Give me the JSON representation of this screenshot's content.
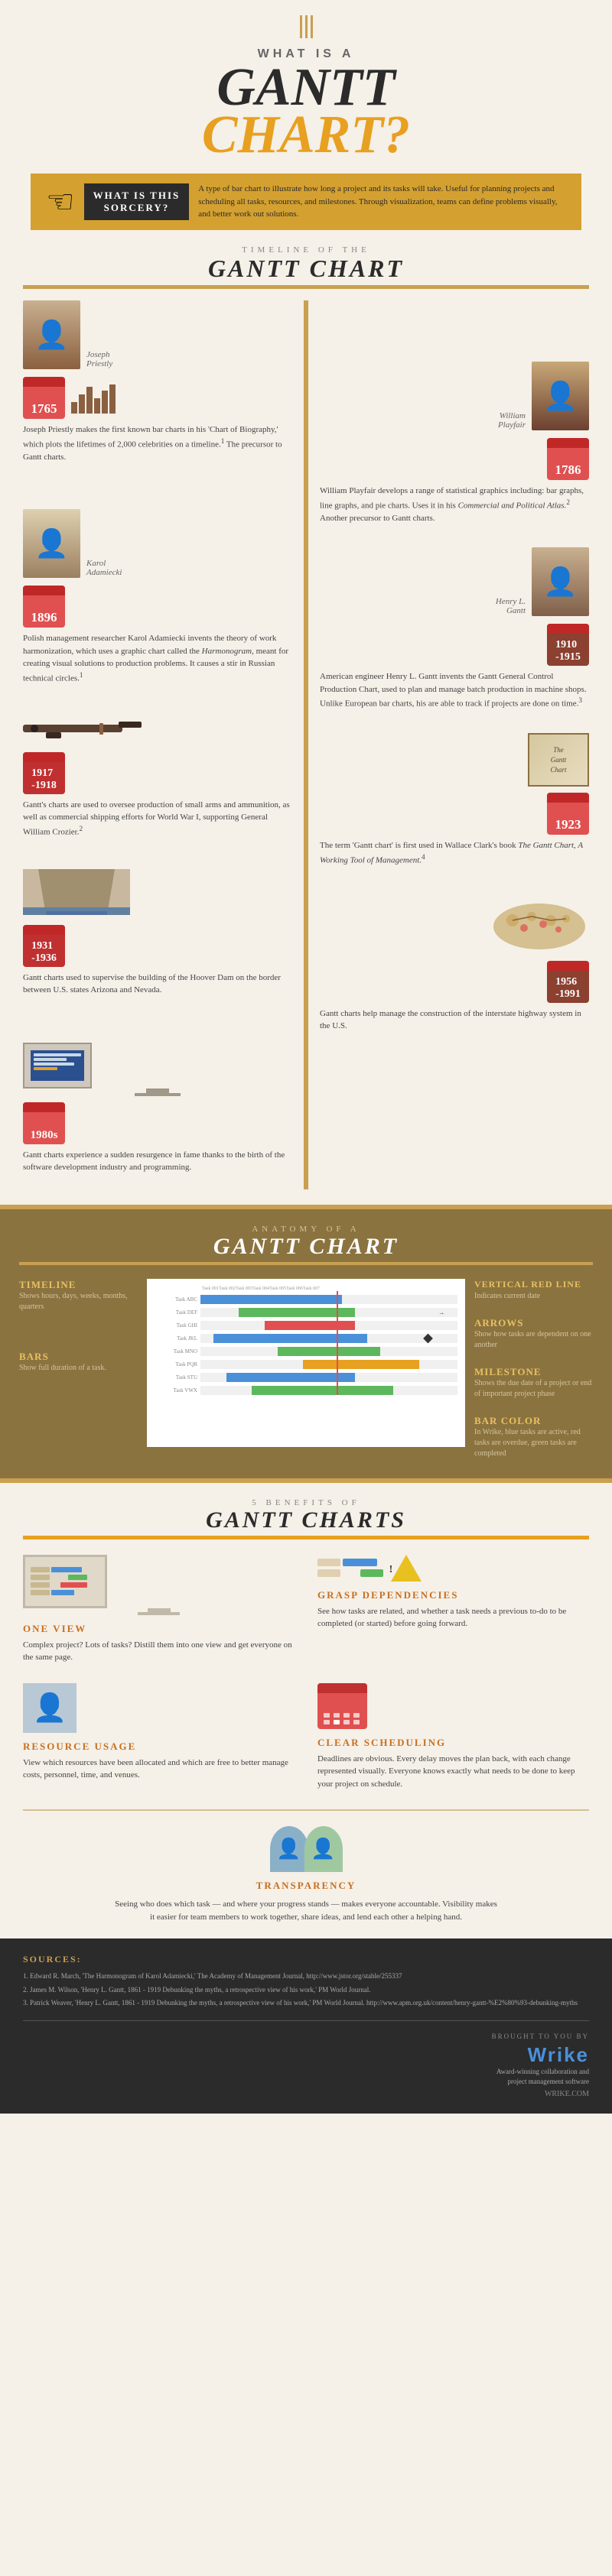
{
  "header": {
    "what_is_label": "WHAT IS A",
    "gantt_label": "GANTT",
    "chart_label": "CHART?",
    "sorcery_title": "WHAT IS THIS",
    "sorcery_title2": "SORCERY?",
    "sorcery_desc": "A type of bar chart to illustrate how long a project and its tasks will take. Useful for planning projects and scheduling all tasks, resources, and milestones. Through visualization, teams can define problems visually, and better work out solutions."
  },
  "timeline": {
    "section_label": "TIMELINE OF THE",
    "section_title": "GANTT CHART",
    "entries": [
      {
        "id": "priestly",
        "year": "1765",
        "name": "Joseph Priestly",
        "side": "left",
        "desc": "Joseph Priestly makes the first known bar charts in his 'Chart of Biography,' which plots the lifetimes of 2,000 celebrities on a timeline. The precursor to Gantt charts."
      },
      {
        "id": "playfair",
        "year": "1786",
        "name": "William Playfair",
        "side": "right",
        "desc": "William Playfair develops a range of statistical graphics including: bar graphs, line graphs, and pie charts. Uses it in his Commercial and Political Atlas. Another precursor to Gantt charts."
      },
      {
        "id": "adamiecki",
        "year": "1896",
        "name": "Karol Adamiecki",
        "side": "left",
        "desc": "Polish management researcher Karol Adamiecki invents the theory of work harmonization, which uses a graphic chart called the Harmonogram, meant for creating visual solutions to production problems. It causes a stir in Russian technical circles."
      },
      {
        "id": "gantt_inventor",
        "year": "1910-1915",
        "name": "Henry L. Gantt",
        "side": "right",
        "desc": "American engineer Henry L. Gantt invents the Gantt General Control Production Chart, used to plan and manage batch production in machine shops. Unlike European bar charts, his are able to track if projects are done on time."
      },
      {
        "id": "wwi",
        "year": "1917-1918",
        "name": "",
        "side": "left",
        "desc": "Gantt's charts are used to oversee production of small arms and ammunition, as well as commercial shipping efforts for World War I, supporting General William Crozier."
      },
      {
        "id": "gantt_book",
        "year": "1923",
        "name": "",
        "side": "right",
        "desc": "The term 'Gantt chart' is first used in Wallace Clark's book The Gantt Chart, A Working Tool of Management."
      },
      {
        "id": "hoover_dam",
        "year": "1931-1936",
        "name": "",
        "side": "left",
        "desc": "Gantt charts used to supervise the building of the Hoover Dam on the border between U.S. states Arizona and Nevada."
      },
      {
        "id": "highway",
        "year": "1956-1991",
        "name": "",
        "side": "right",
        "desc": "Gantt charts help manage the construction of the interstate highway system in the U.S."
      },
      {
        "id": "software",
        "year": "1980s",
        "name": "",
        "side": "left",
        "desc": "Gantt charts experience a sudden resurgence in fame thanks to the birth of the software development industry and programming."
      }
    ]
  },
  "anatomy": {
    "section_label": "ANATOMY OF A",
    "section_title": "GANTT CHART",
    "labels": [
      {
        "title": "Timeline",
        "desc": "Shows hours, days, weeks, months, quarters",
        "side": "left"
      },
      {
        "title": "Bars",
        "desc": "Show full duration of a task.",
        "side": "left"
      },
      {
        "title": "Vertical Red Line",
        "desc": "Indicates current date",
        "side": "right"
      },
      {
        "title": "Arrows",
        "desc": "Show how tasks are dependent on one another",
        "side": "right"
      },
      {
        "title": "Milestone",
        "desc": "Shows the due date of a project or end of important project phase",
        "side": "right"
      },
      {
        "title": "Bar Color",
        "desc": "In Wrike, blue tasks are active, red tasks are overdue, green tasks are completed",
        "side": "right"
      }
    ]
  },
  "benefits": {
    "section_label": "5 BENEFITS OF",
    "section_title": "GANTT CHARTS",
    "items": [
      {
        "id": "one_view",
        "title": "ONE VIEW",
        "desc": "Complex project? Lots of tasks? Distill them into one view and get everyone on the same page.",
        "icon": "monitor"
      },
      {
        "id": "grasp_dep",
        "title": "GRASP DEPENDENCIES",
        "desc": "See how tasks are related, and whether a task needs a previous to-do to be completed (or started) before going forward.",
        "icon": "dependency"
      },
      {
        "id": "resource_usage",
        "title": "RESOURCE USAGE",
        "desc": "View which resources have been allocated and which are free to better manage costs, personnel, time, and venues.",
        "icon": "person"
      },
      {
        "id": "clear_scheduling",
        "title": "CLEAR SCHEDULING",
        "desc": "Deadlines are obvious. Every delay moves the plan back, with each change represented visually. Everyone knows exactly what needs to be done to keep your project on schedule.",
        "icon": "calendar"
      },
      {
        "id": "transparency",
        "title": "TRANSPARENCY",
        "desc": "Seeing who does which task — and where your progress stands — makes everyone accountable. Visibility makes it easier for team members to work together, share ideas, and lend each other a helping hand.",
        "icon": "people"
      }
    ]
  },
  "footer": {
    "sources_label": "SOURCES:",
    "sources": [
      "1. Edward R. March, 'The Harmonogram of Karol Adamiecki,' The Academy of Management Journal, http://www.jstor.org/stable/255337",
      "2. James M. Wilson, 'Henry L. Gantt, 1861 - 1919 Debunking the myths, a retrospective view of his work,' PM World Journal.",
      "3. Patrick Weaver, 'Henry L. Gantt, 1861 - 1919 Debunking the myths, a retrospective view of his work,' PM World Journal. http://www.apm.org.uk/content/henry-gantt-%E2%80%93-debunking-myths"
    ],
    "brought_by": "BROUGHT TO YOU BY",
    "wrike_name": "Wrike",
    "wrike_tagline": "Award-winning collaboration and\nproject management software",
    "wrike_url": "WRIKE.COM"
  },
  "colors": {
    "orange": "#e8a020",
    "dark": "#2b2b2b",
    "gold": "#c8a050",
    "blue": "#4a90d9",
    "green": "#5db85d",
    "red": "#e05050",
    "bg": "#f5f0e8"
  }
}
